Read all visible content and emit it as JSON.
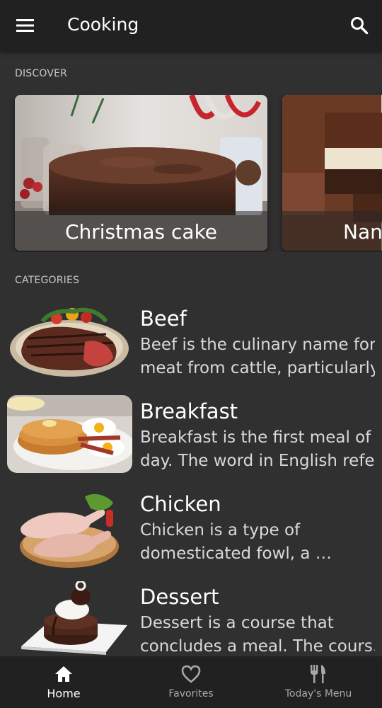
{
  "app_bar": {
    "title": "Cooking",
    "menu_icon": "hamburger-menu-icon",
    "search_icon": "search-icon"
  },
  "discover": {
    "label": "DISCOVER",
    "cards": [
      {
        "title": "Christmas cake"
      },
      {
        "title": "Nan"
      }
    ]
  },
  "categories": {
    "label": "CATEGORIES",
    "items": [
      {
        "name": "Beef",
        "line1": "Beef is the culinary name for",
        "line2": "meat from cattle, particularly…"
      },
      {
        "name": "Breakfast",
        "line1": "Breakfast is the first meal of a",
        "line2": "day. The word in English refe…"
      },
      {
        "name": "Chicken",
        "line1": "Chicken is a type of",
        "line2": "domesticated fowl, a …"
      },
      {
        "name": "Dessert",
        "line1": "Dessert is a course that",
        "line2": "concludes a meal. The cours…"
      }
    ]
  },
  "bottom_nav": {
    "items": [
      {
        "label": "Home",
        "icon": "home-icon",
        "active": true
      },
      {
        "label": "Favorites",
        "icon": "heart-outline-icon",
        "active": false
      },
      {
        "label": "Today's Menu",
        "icon": "fork-knife-icon",
        "active": false
      }
    ]
  },
  "colors": {
    "background": "#303030",
    "app_bar": "#212121",
    "secondary_text": "#d9d9d9"
  }
}
